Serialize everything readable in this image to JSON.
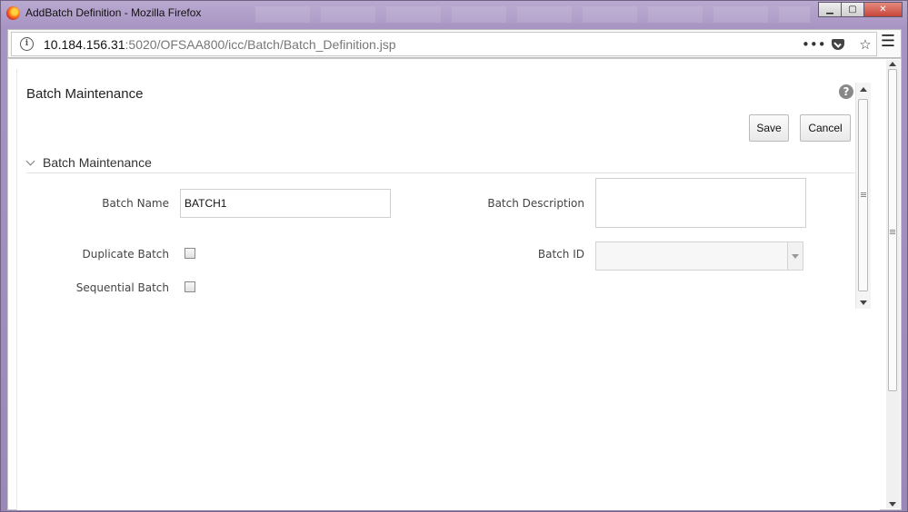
{
  "window": {
    "title": "AddBatch Definition - Mozilla Firefox",
    "controls": {
      "minimize": "▁",
      "maximize": "▢",
      "close": "✕"
    }
  },
  "address_bar": {
    "host": "10.184.156.31",
    "path": ":5020/OFSAA800/icc/Batch/Batch_Definition.jsp",
    "icons": [
      "info-icon",
      "more-actions-icon",
      "pocket-icon",
      "bookmark-star-icon",
      "hamburger-menu-icon"
    ],
    "more": "•••",
    "star": "☆",
    "menu": "☰"
  },
  "page": {
    "title": "Batch Maintenance",
    "help": "?",
    "buttons": {
      "save": "Save",
      "cancel": "Cancel"
    },
    "section_title": "Batch Maintenance",
    "form": {
      "batch_name_label": "Batch Name",
      "batch_name_value": "BATCH1",
      "batch_description_label": "Batch Description",
      "batch_description_value": "",
      "duplicate_batch_label": "Duplicate Batch",
      "duplicate_batch_checked": false,
      "batch_id_label": "Batch ID",
      "batch_id_value": "",
      "sequential_batch_label": "Sequential Batch",
      "sequential_batch_checked": false
    }
  },
  "colors": {
    "window_frame": "#a894c3",
    "help_icon": "#888888",
    "close_button": "#c7453a"
  }
}
